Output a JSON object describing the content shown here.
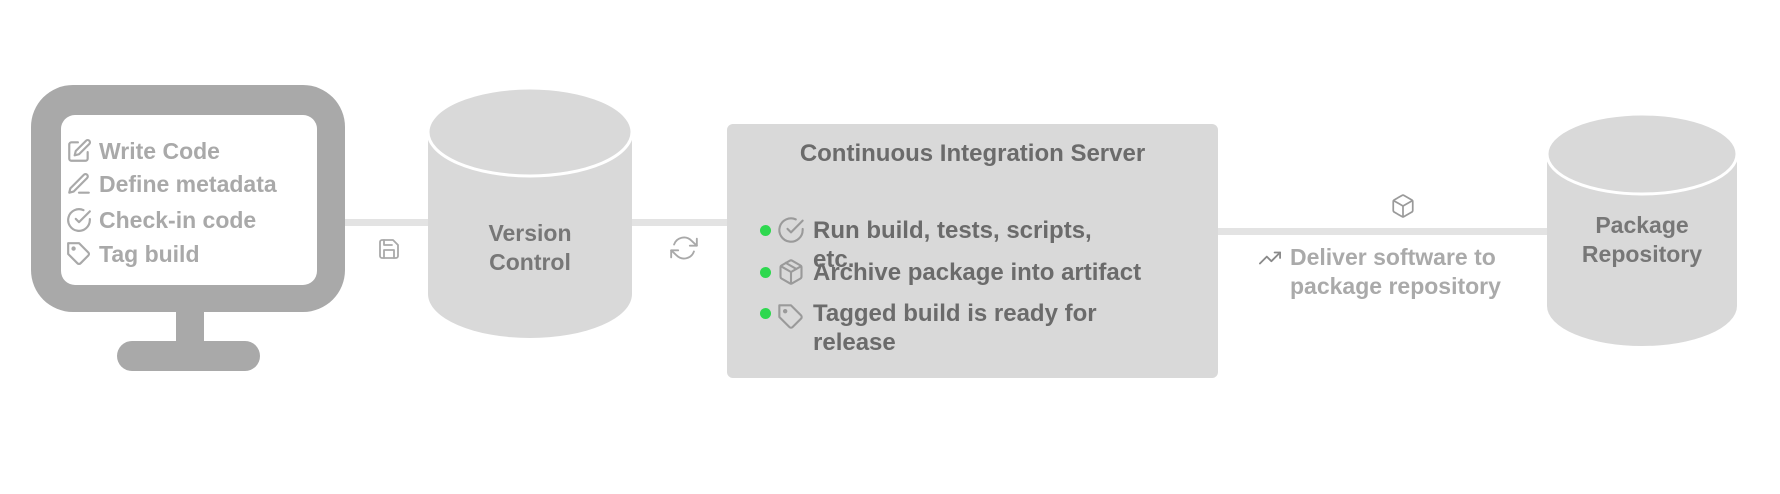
{
  "workstation": {
    "items": [
      {
        "icon": "edit-icon",
        "label": "Write Code"
      },
      {
        "icon": "pen-icon",
        "label": "Define metadata"
      },
      {
        "icon": "check-circle-icon",
        "label": "Check-in code"
      },
      {
        "icon": "tag-icon",
        "label": "Tag build"
      }
    ]
  },
  "version_control": {
    "label_line1": "Version",
    "label_line2": "Control"
  },
  "ci_server": {
    "title": "Continuous Integration Server",
    "items": [
      {
        "icon": "check-circle-icon",
        "label": "Run build, tests, scripts, etc."
      },
      {
        "icon": "package-icon",
        "label": "Archive package into artifact"
      },
      {
        "icon": "tag-icon",
        "label": "Tagged build is ready for release"
      }
    ]
  },
  "delivery": {
    "line1": "Deliver software to",
    "line2": "package repository",
    "icon": "trending-up-icon",
    "package_icon": "package-icon"
  },
  "package_repository": {
    "label_line1": "Package",
    "label_line2": "Repository"
  },
  "connectors": {
    "save_icon": "save-icon",
    "sync_icon": "sync-icon"
  },
  "colors": {
    "monitor": "#a9a9a9",
    "cylinder": "#d9d9d9",
    "ci_box": "#d9d9d9",
    "connector": "#e3e3e3",
    "bullet": "#2ed84f",
    "dark_text": "#6b6b6b",
    "light_text": "#a9a9a9"
  }
}
